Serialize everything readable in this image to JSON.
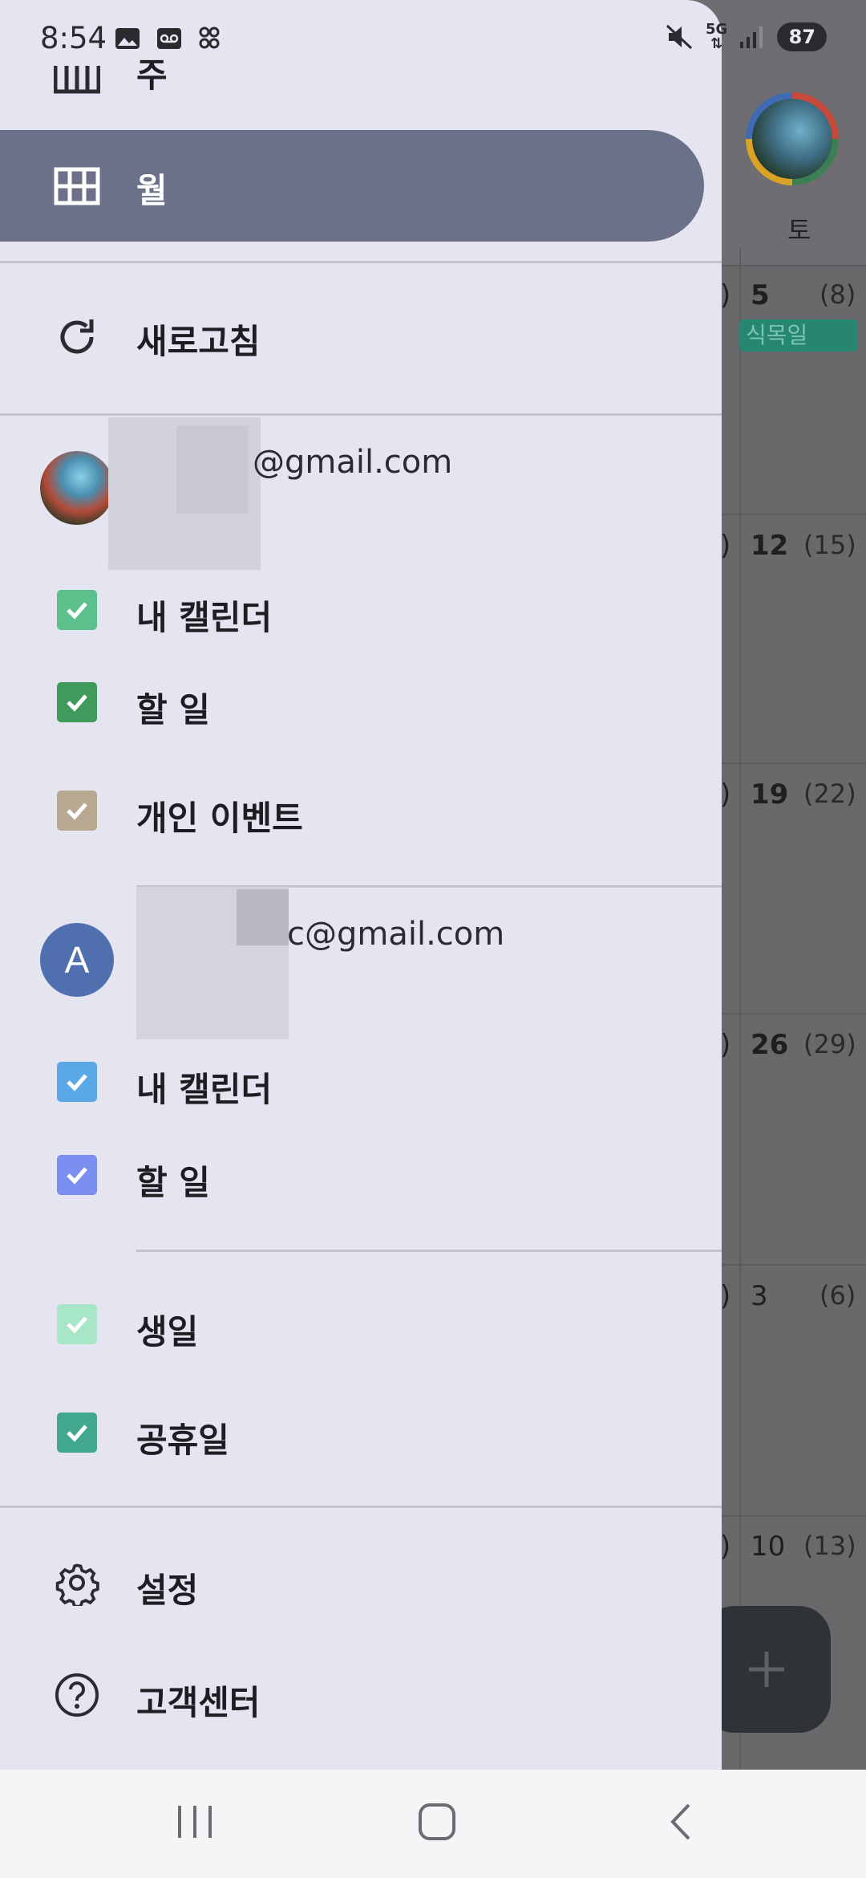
{
  "status_bar": {
    "time": "8:54",
    "network": "5G",
    "battery": "87"
  },
  "drawer": {
    "partial_item": {
      "label": "주",
      "icon": "week-view-icon"
    },
    "view_month": {
      "label": "월",
      "icon": "grid-icon"
    },
    "refresh": {
      "label": "새로고침",
      "icon": "refresh-icon"
    },
    "account1": {
      "email": "@gmail.com",
      "calendars": [
        {
          "label": "내 캘린더",
          "color": "#5cc08c"
        },
        {
          "label": "할 일",
          "color": "#3f9a5c"
        },
        {
          "label": "개인 이벤트",
          "color": "#b8a892"
        }
      ]
    },
    "account2": {
      "avatar_letter": "A",
      "email": "c@gmail.com",
      "calendars": [
        {
          "label": "내 캘린더",
          "color": "#5aa9e6"
        },
        {
          "label": "할 일",
          "color": "#7b8ff0"
        }
      ]
    },
    "other_calendars": [
      {
        "label": "생일",
        "color": "#a8e6c8"
      },
      {
        "label": "공휴일",
        "color": "#42a78f"
      }
    ],
    "settings": {
      "label": "설정",
      "icon": "gear-icon"
    },
    "help": {
      "label": "고객센터",
      "icon": "help-icon"
    }
  },
  "background_calendar": {
    "day_header": "토",
    "dates": [
      {
        "date": "5",
        "lunar": "(8)"
      },
      {
        "date": "12",
        "lunar": "(15)"
      },
      {
        "date": "19",
        "lunar": "(22)"
      },
      {
        "date": "26",
        "lunar": "(29)"
      },
      {
        "date": "3",
        "lunar": "(6)"
      },
      {
        "date": "10",
        "lunar": "(13)"
      }
    ],
    "event": "식목일",
    "paren": ")"
  },
  "colors": {
    "drawer_bg": "#e5e5f1",
    "selected_bg": "#6b7188",
    "account2_avatar": "#4f6fae"
  }
}
